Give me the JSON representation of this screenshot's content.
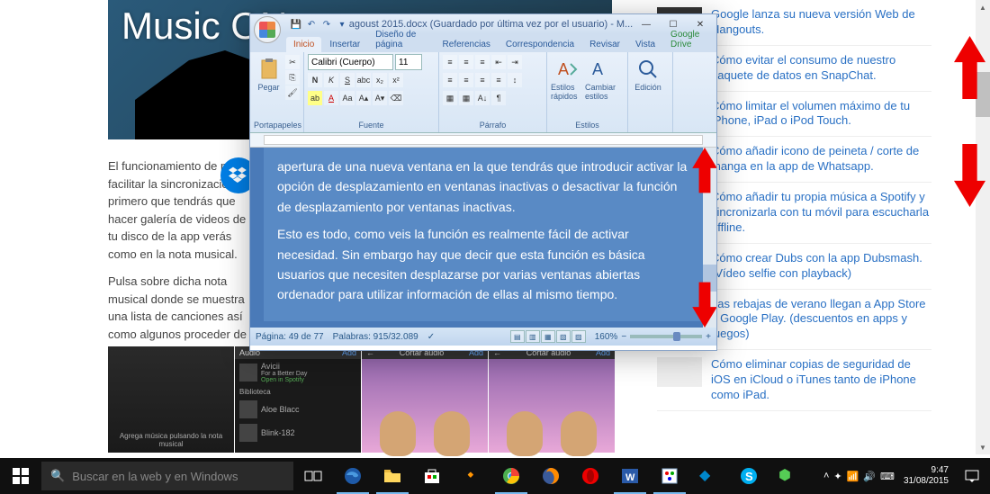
{
  "page": {
    "banner_text": "Music ON",
    "article_p1": "El funcionamiento de para facilitar la sincronización primero que tendrás que hacer galería de videos de tu disco de la app verás como en la nota musical.",
    "article_p2": "Pulsa sobre dicha nota musical donde se muestra una lista de canciones así como algunos proceder de Spotify.",
    "thumb1_caption": "Agrega música pulsando la nota musical",
    "thumb2_header": "Audio",
    "thumb2_add": "Add",
    "thumb2_artist1": "Avicii",
    "thumb2_song1": "For a Better Day",
    "thumb2_open": "Open in Spotify",
    "thumb2_section": "Biblioteca",
    "thumb2_artist2": "Aloe Blacc",
    "thumb2_artist3": "Blink-182",
    "thumb3_header": "Cortar audio",
    "thumb4_header": "Cortar audio"
  },
  "sidebar": {
    "items": [
      "Google lanza su nueva versión Web de Hangouts.",
      "Cómo evitar el consumo de nuestro paquete de datos en SnapChat.",
      "Cómo limitar el volumen máximo de tu iPhone, iPad o iPod Touch.",
      "Cómo añadir icono de peineta / corte de manga en la app de Whatsapp.",
      "Cómo añadir tu propia música a Spotify y sincronizarla con tu móvil para escucharla offline.",
      "Cómo crear Dubs con la app Dubsmash. (Vídeo selfie con playback)",
      "Las rebajas de verano llegan a App Store y Google Play. (descuentos en apps y juegos)",
      "Cómo eliminar copias de seguridad de iOS en iCloud o iTunes tanto de iPhone como iPad."
    ]
  },
  "word": {
    "title": "agoust 2015.docx (Guardado por última vez por el usuario) - M...",
    "tabs": [
      "Inicio",
      "Insertar",
      "Diseño de página",
      "Referencias",
      "Correspondencia",
      "Revisar",
      "Vista",
      "Google Drive"
    ],
    "active_tab": 0,
    "ribbon": {
      "portapapeles": "Portapapeles",
      "pegar": "Pegar",
      "fuente": "Fuente",
      "font_name": "Calibri (Cuerpo)",
      "font_size": "11",
      "parrafo": "Párrafo",
      "estilos": "Estilos",
      "estilos_rapidos": "Estilos rápidos",
      "cambiar_estilos": "Cambiar estilos",
      "edicion": "Edición"
    },
    "doc_paragraphs": [
      "apertura de una nueva ventana en la que tendrás que introducir activar la opción de desplazamiento en ventanas inactivas o desactivar la función de desplazamiento por ventanas inactivas.",
      "Esto es todo, como veis la función es realmente fácil de activar necesidad. Sin embargo hay que decir que esta función es básica usuarios que necesiten desplazarse por varias ventanas abiertas ordenador para utilizar información de ellas al mismo tiempo."
    ],
    "status": {
      "page": "Página: 49 de 77",
      "words": "Palabras: 915/32.089",
      "zoom": "160%"
    }
  },
  "taskbar": {
    "search_placeholder": "Buscar en la web y en Windows",
    "time": "9:47",
    "date": "31/08/2015"
  }
}
